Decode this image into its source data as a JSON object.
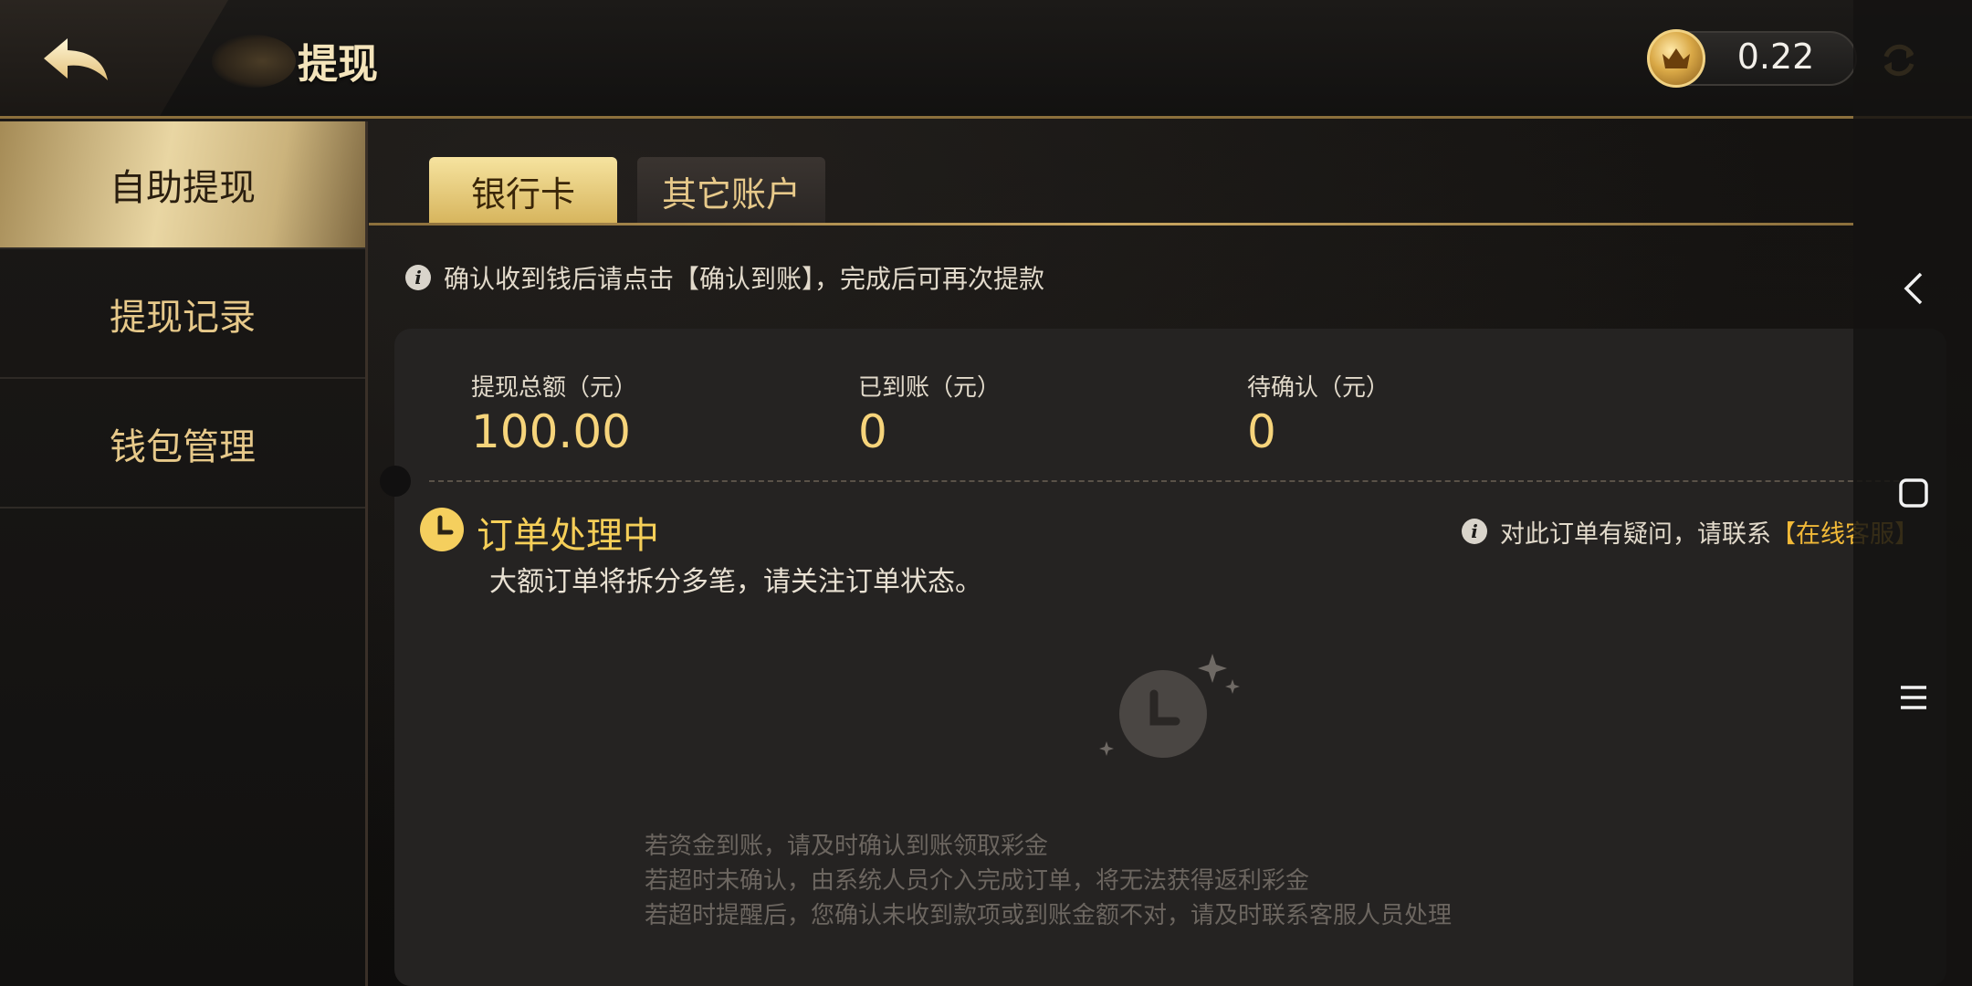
{
  "header": {
    "title": "提现",
    "balance": "0.22"
  },
  "sidebar": {
    "items": [
      {
        "label": "自助提现",
        "active": true
      },
      {
        "label": "提现记录",
        "active": false
      },
      {
        "label": "钱包管理",
        "active": false
      }
    ]
  },
  "tabs": [
    {
      "label": "银行卡",
      "active": true
    },
    {
      "label": "其它账户",
      "active": false
    }
  ],
  "notice": "确认收到钱后请点击【确认到账】，完成后可再次提款",
  "stats": [
    {
      "label": "提现总额（元）",
      "value": "100.00"
    },
    {
      "label": "已到账（元）",
      "value": "0"
    },
    {
      "label": "待确认（元）",
      "value": "0"
    }
  ],
  "order": {
    "status_title": "订单处理中",
    "status_subtitle": "大额订单将拆分多笔，请关注订单状态。",
    "help_prefix": "对此订单有疑问，请联系",
    "help_link": "【在线客服】"
  },
  "hints": [
    "若资金到账，请及时确认到账领取彩金",
    "若超时未确认，由系统人员介入完成订单，将无法获得返利彩金",
    "若超时提醒后，您确认未收到款项或到账金额不对，请及时联系客服人员处理"
  ],
  "colors": {
    "gold": "#f6cf58",
    "accent_link": "#f1b938",
    "tab_active": "#d6b45c",
    "card_bg": "#252322"
  },
  "icons": {
    "back": "back-arrow-icon",
    "coin": "crown-coin-icon",
    "refresh": "refresh-icon",
    "info": "info-icon",
    "clock": "clock-icon"
  }
}
